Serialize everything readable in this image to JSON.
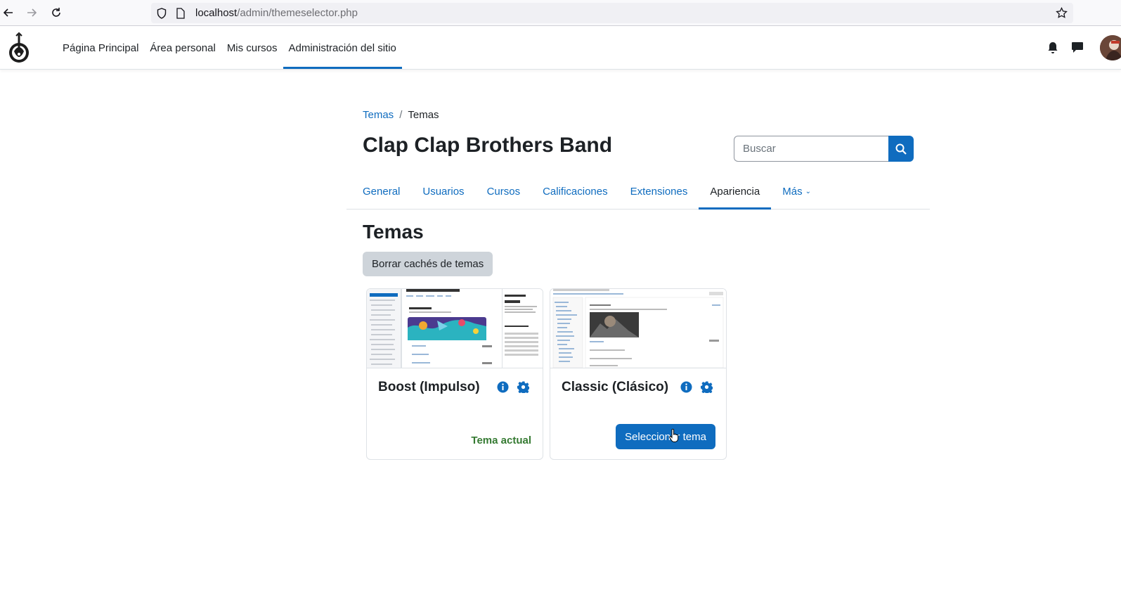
{
  "browser": {
    "url_host": "localhost",
    "url_path": "/admin/themeselector.php"
  },
  "navbar": {
    "items": [
      {
        "label": "Página Principal"
      },
      {
        "label": "Área personal"
      },
      {
        "label": "Mis cursos"
      },
      {
        "label": "Administración del sitio",
        "active": true
      }
    ]
  },
  "breadcrumb": {
    "link": "Temas",
    "current": "Temas"
  },
  "page": {
    "title": "Clap Clap Brothers Band"
  },
  "search": {
    "placeholder": "Buscar"
  },
  "secondary_nav": {
    "tabs": [
      {
        "label": "General"
      },
      {
        "label": "Usuarios"
      },
      {
        "label": "Cursos"
      },
      {
        "label": "Calificaciones"
      },
      {
        "label": "Extensiones"
      },
      {
        "label": "Apariencia",
        "active": true
      },
      {
        "label": "Más"
      }
    ]
  },
  "section": {
    "title": "Temas",
    "purge_label": "Borrar cachés de temas"
  },
  "themes": [
    {
      "name": "Boost (Impulso)",
      "status": "Tema actual"
    },
    {
      "name": "Classic (Clásico)",
      "action": "Seleccionar tema"
    }
  ],
  "colors": {
    "primary": "#0f6cbf",
    "success": "#357a32",
    "secondary_btn": "#ced4da"
  }
}
